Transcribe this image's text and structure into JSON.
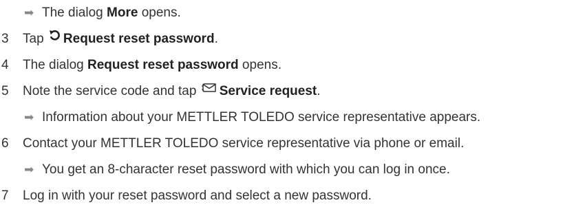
{
  "steps": [
    {
      "kind": "result",
      "arrow": "➡",
      "parts": [
        "The dialog ",
        "More",
        " opens."
      ]
    },
    {
      "kind": "step",
      "number": "3",
      "icon": "undo-icon",
      "parts": [
        "Tap ",
        "Request reset password",
        "."
      ]
    },
    {
      "kind": "step",
      "number": "4",
      "parts": [
        "The dialog ",
        "Request reset password",
        " opens."
      ]
    },
    {
      "kind": "step",
      "number": "5",
      "icon": "mail-icon",
      "parts": [
        "Note the service code and tap ",
        "Service request",
        "."
      ]
    },
    {
      "kind": "result",
      "arrow": "➡",
      "parts": [
        "Information about your METTLER TOLEDO service representative appears."
      ]
    },
    {
      "kind": "step",
      "number": "6",
      "parts": [
        "Contact your METTLER TOLEDO service representative via phone or email."
      ]
    },
    {
      "kind": "result",
      "arrow": "➡",
      "parts": [
        "You get an 8-character reset password with which you can log in once."
      ]
    },
    {
      "kind": "step",
      "number": "7",
      "parts": [
        "Log in with your reset password and select a new password."
      ]
    }
  ]
}
